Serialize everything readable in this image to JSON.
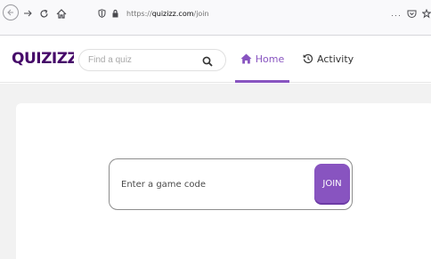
{
  "browser": {
    "url_prefix": "https://",
    "url_domain": "quizizz.com",
    "url_path": "/join",
    "more": "···"
  },
  "header": {
    "logo_text": "QUIZIZZ",
    "search_placeholder": "Find a quiz",
    "tabs": [
      {
        "label": "Home",
        "icon": "home-icon",
        "active": true
      },
      {
        "label": "Activity",
        "icon": "history-icon",
        "active": false
      }
    ]
  },
  "join": {
    "placeholder": "Enter a game code",
    "button_label": "JOIN"
  },
  "colors": {
    "brand": "#8854c0",
    "logo": "#460a69",
    "background": "#f2f2f2"
  }
}
